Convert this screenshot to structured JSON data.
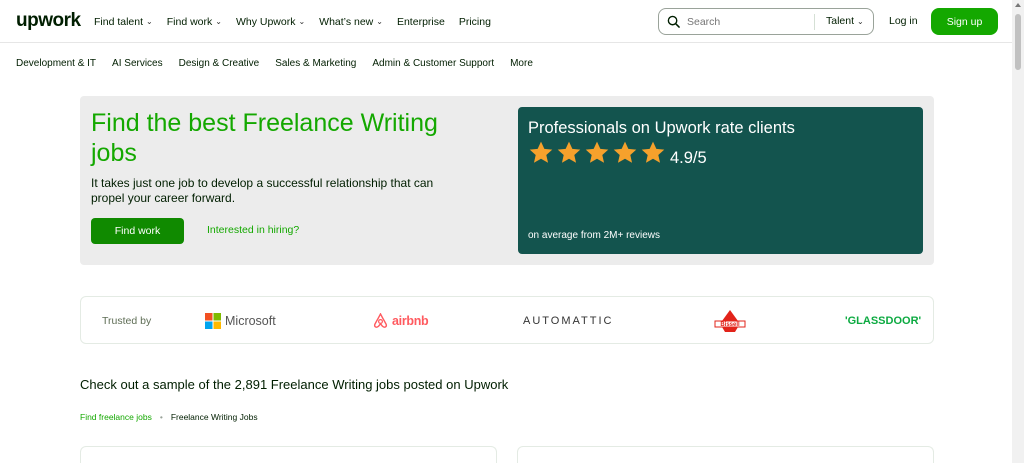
{
  "header": {
    "logo": "upwork",
    "nav": [
      {
        "label": "Find talent",
        "dropdown": true
      },
      {
        "label": "Find work",
        "dropdown": true
      },
      {
        "label": "Why Upwork",
        "dropdown": true
      },
      {
        "label": "What’s new",
        "dropdown": true
      },
      {
        "label": "Enterprise",
        "dropdown": false
      },
      {
        "label": "Pricing",
        "dropdown": false
      }
    ],
    "search": {
      "placeholder": "Search",
      "value": "",
      "category": "Talent"
    },
    "login_label": "Log in",
    "signup_label": "Sign up"
  },
  "categories": [
    "Development & IT",
    "AI Services",
    "Design & Creative",
    "Sales & Marketing",
    "Admin & Customer Support",
    "More"
  ],
  "hero": {
    "title": "Find the best Freelance Writing jobs",
    "subtitle": "It takes just one job to develop a successful relationship that can propel your career forward.",
    "primary_button": "Find work",
    "secondary_link": "Interested in hiring?",
    "rating": {
      "title": "Professionals on Upwork rate clients",
      "star_count": 5,
      "score": "4.9/5",
      "footnote": "on average from 2M+ reviews"
    }
  },
  "trusted": {
    "label": "Trusted by",
    "brands": [
      "Microsoft",
      "airbnb",
      "AUTOMATTIC",
      "Bissell",
      "'GLASSDOOR'"
    ]
  },
  "sample_heading": "Check out a sample of the 2,891 Freelance Writing jobs posted on Upwork",
  "breadcrumb": {
    "link": "Find freelance jobs",
    "current": "Freelance Writing Jobs"
  },
  "colors": {
    "brand_green": "#14a800",
    "button_green": "#108a00",
    "card_teal": "#13544e",
    "star": "#f6a12c",
    "hero_bg": "#ececec"
  }
}
